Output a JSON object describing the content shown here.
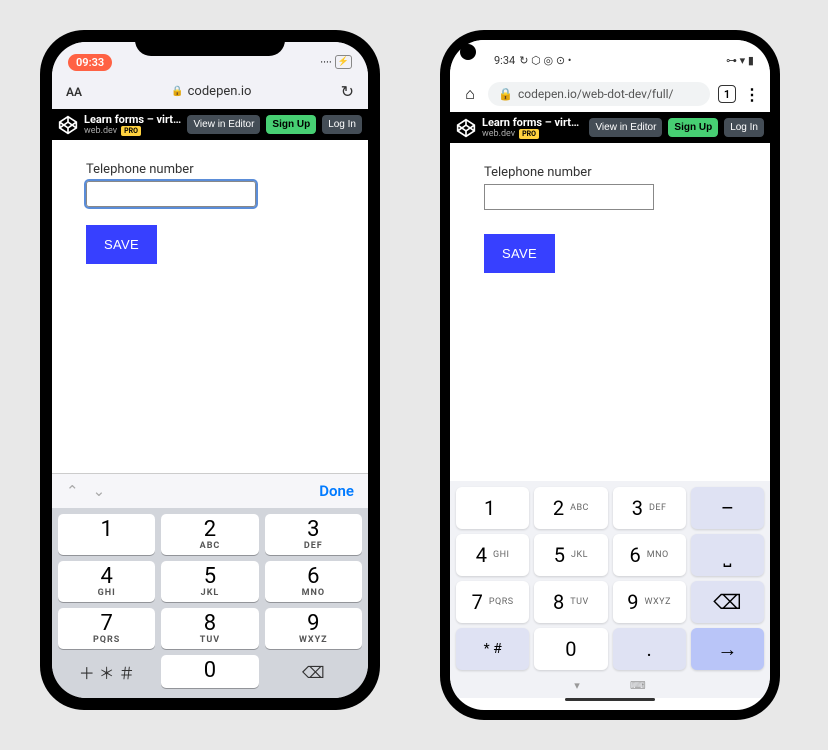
{
  "ios": {
    "status": {
      "time": "09:33",
      "battery": "⚡"
    },
    "chrome": {
      "aa": "AA",
      "lock": "🔒",
      "url": "codepen.io",
      "reload": "↻"
    },
    "keyboard": {
      "done": "Done",
      "symbols": "＋ ＊ ＃",
      "keys": [
        {
          "n": "1",
          "l": ""
        },
        {
          "n": "2",
          "l": "ABC"
        },
        {
          "n": "3",
          "l": "DEF"
        },
        {
          "n": "4",
          "l": "GHI"
        },
        {
          "n": "5",
          "l": "JKL"
        },
        {
          "n": "6",
          "l": "MNO"
        },
        {
          "n": "7",
          "l": "PQRS"
        },
        {
          "n": "8",
          "l": "TUV"
        },
        {
          "n": "9",
          "l": "WXYZ"
        }
      ],
      "zero": "0",
      "backspace": "⌫"
    }
  },
  "android": {
    "status": {
      "time": "9:34",
      "icons_left": "↻ ⬡ ◎ ⊙ •",
      "icons_right": "⊶ ▾ ▮"
    },
    "chrome": {
      "home": "⌂",
      "lock": "🔒",
      "url": "codepen.io/web-dot-dev/full/",
      "tabs": "1",
      "menu": "⋮"
    },
    "keyboard": {
      "keys": [
        {
          "n": "1",
          "l": ""
        },
        {
          "n": "2",
          "l": "ABC"
        },
        {
          "n": "3",
          "l": "DEF"
        },
        {
          "n": "4",
          "l": "GHI"
        },
        {
          "n": "5",
          "l": "JKL"
        },
        {
          "n": "6",
          "l": "MNO"
        },
        {
          "n": "7",
          "l": "PQRS"
        },
        {
          "n": "8",
          "l": "TUV"
        },
        {
          "n": "9",
          "l": "WXYZ"
        }
      ],
      "dash": "–",
      "space": "⎵",
      "backspace": "⌫",
      "star": "* #",
      "zero": "0",
      "dot": ".",
      "go": "→",
      "bottom_left": "▾",
      "bottom_right": "⌨"
    }
  },
  "codepen": {
    "title": "Learn forms – virt…",
    "author": "web.dev",
    "pro": "PRO",
    "view_btn": "View in Editor",
    "signup_btn": "Sign Up",
    "login_btn": "Log In"
  },
  "page": {
    "label": "Telephone number",
    "save": "SAVE"
  }
}
